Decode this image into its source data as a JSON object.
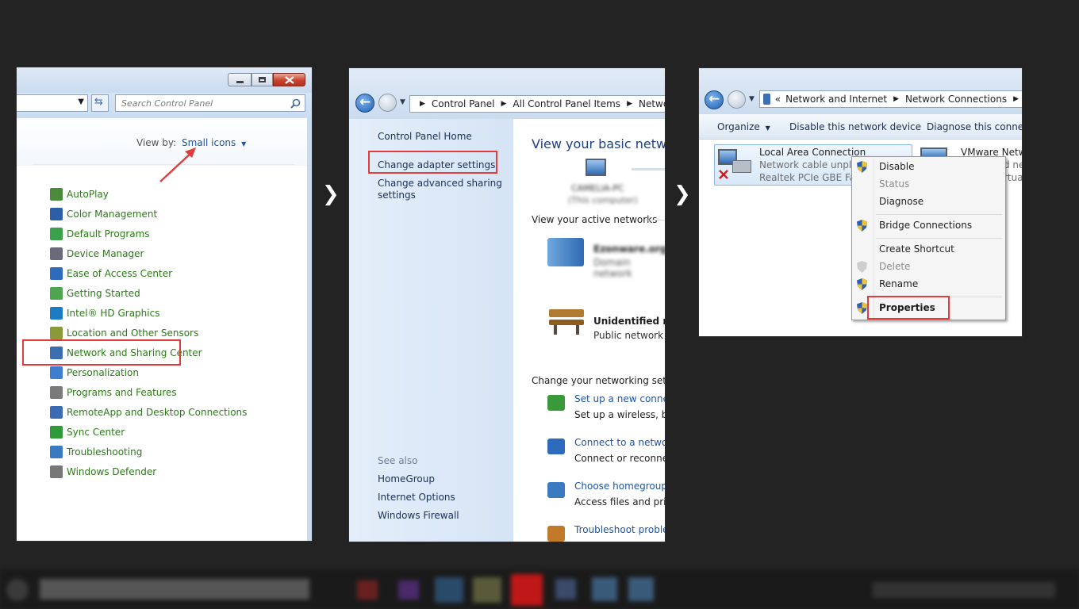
{
  "panel1": {
    "search_placeholder": "Search Control Panel",
    "view_by_label": "View by:",
    "view_by_value": "Small icons",
    "items": [
      {
        "label": "AutoPlay",
        "color": "#4a8a3a"
      },
      {
        "label": "Color Management",
        "color": "#2c5fa8"
      },
      {
        "label": "Default Programs",
        "color": "#3aa04a"
      },
      {
        "label": "Device Manager",
        "color": "#6a6a7a"
      },
      {
        "label": "Ease of Access Center",
        "color": "#2f6bbd"
      },
      {
        "label": "Getting Started",
        "color": "#4fa54f"
      },
      {
        "label": "Intel® HD Graphics",
        "color": "#1b7cc4"
      },
      {
        "label": "Location and Other Sensors",
        "color": "#8a9a3a"
      },
      {
        "label": "Network and Sharing Center",
        "color": "#3b6fb0"
      },
      {
        "label": "Personalization",
        "color": "#3e7ed1"
      },
      {
        "label": "Programs and Features",
        "color": "#7a7a7a"
      },
      {
        "label": "RemoteApp and Desktop Connections",
        "color": "#3c6ab0"
      },
      {
        "label": "Sync Center",
        "color": "#2f9a3a"
      },
      {
        "label": "Troubleshooting",
        "color": "#3a7ac0"
      },
      {
        "label": "Windows Defender",
        "color": "#777777"
      }
    ]
  },
  "panel2": {
    "breadcrumb": [
      "Control Panel",
      "All Control Panel Items",
      "Network"
    ],
    "sidebar": {
      "home": "Control Panel Home",
      "adapter": "Change adapter settings",
      "advanced_line1": "Change advanced sharing",
      "advanced_line2": "settings",
      "see_also": "See also",
      "homegroup": "HomeGroup",
      "internet_options": "Internet Options",
      "firewall": "Windows Firewall"
    },
    "heading": "View your basic network",
    "computer_name": "CAMELIA-PC",
    "computer_sub": "(This computer)",
    "active_networks": "View your active networks",
    "network1_name": "Ezonware.org",
    "network1_type": "Domain network",
    "network2_name": "Unidentified net",
    "network2_type": "Public network",
    "change_settings": "Change your networking setting",
    "tasks": [
      {
        "link": "Set up a new connect",
        "desc": "Set up a wireless, broa"
      },
      {
        "link": "Connect to a network",
        "desc": "Connect or reconnect"
      },
      {
        "link": "Choose homegroup a",
        "desc": "Access files and printe"
      },
      {
        "link": "Troubleshoot problem",
        "desc": ""
      }
    ]
  },
  "panel3": {
    "breadcrumb": [
      "Network and Internet",
      "Network Connections"
    ],
    "toolbar": {
      "organize": "Organize",
      "disable": "Disable this network device",
      "diagnose": "Diagnose this connecti"
    },
    "connection": {
      "name": "Local Area Connection",
      "status": "Network cable unplug",
      "adapter": "Realtek PCIe GBE Fam"
    },
    "connection2": {
      "name": "VMware Netwo",
      "status": "d ne",
      "adapter": "rtua"
    },
    "menu": {
      "disable": "Disable",
      "status": "Status",
      "diagnose": "Diagnose",
      "bridge": "Bridge Connections",
      "shortcut": "Create Shortcut",
      "delete": "Delete",
      "rename": "Rename",
      "properties": "Properties"
    }
  },
  "colors": {
    "highlight": "#e23b3b",
    "link_green": "#2a7a16",
    "link_blue": "#1c54a6"
  }
}
